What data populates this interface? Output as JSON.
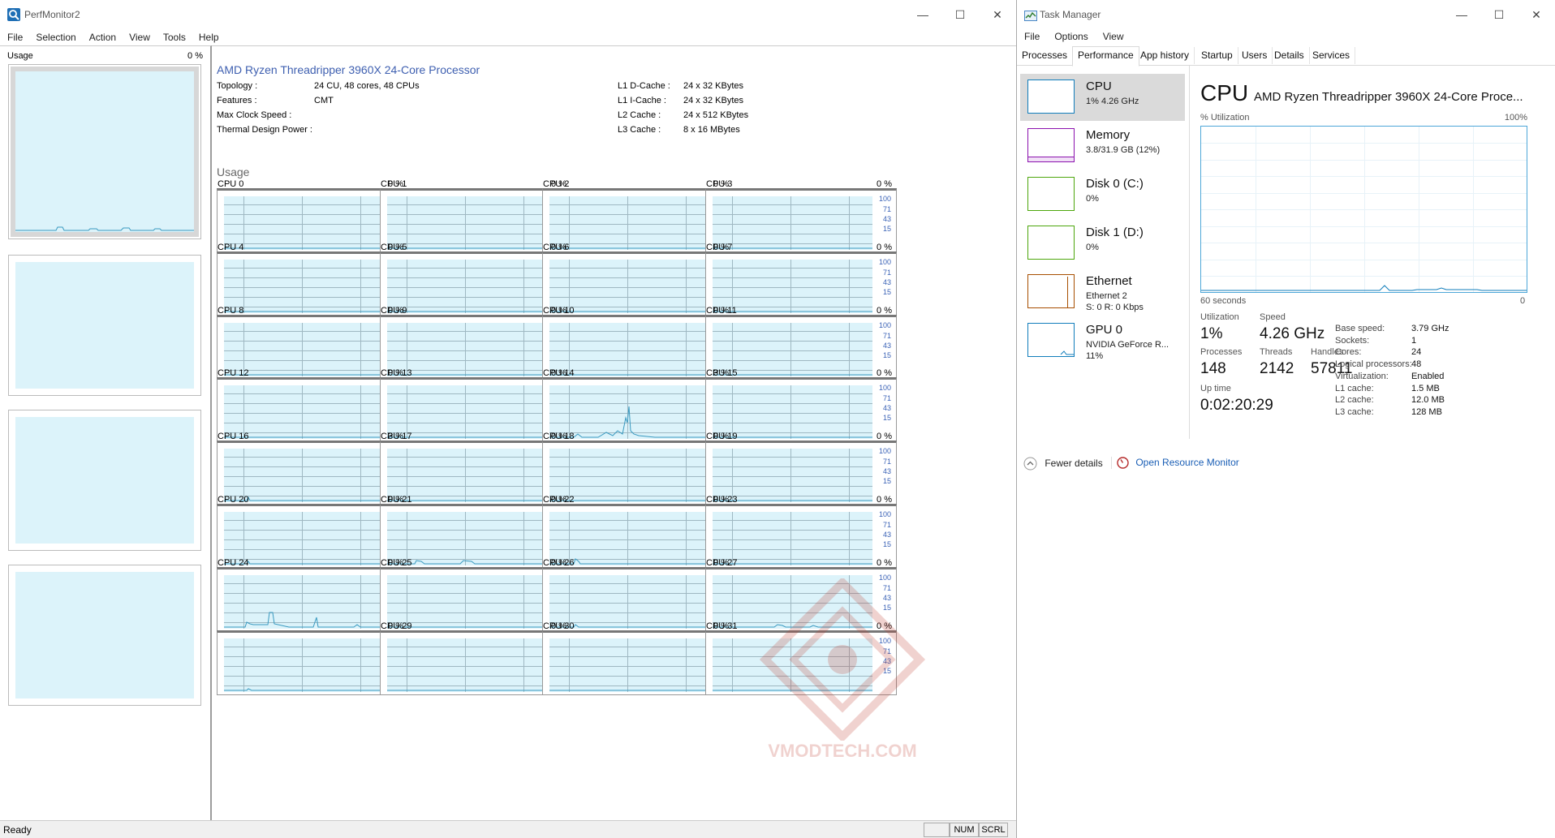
{
  "perfmon": {
    "title": "PerfMonitor2",
    "menu": [
      "File",
      "Selection",
      "Action",
      "View",
      "Tools",
      "Help"
    ],
    "left_panel": {
      "label": "Usage",
      "value": "0 %"
    },
    "processor_name": "AMD Ryzen Threadripper 3960X 24-Core Processor",
    "info_left": [
      {
        "key": "Topology :",
        "value": "24 CU, 48 cores, 48 CPUs"
      },
      {
        "key": "Features :",
        "value": "CMT"
      },
      {
        "key": "Max Clock Speed :",
        "value": ""
      },
      {
        "key": "Thermal Design Power :",
        "value": ""
      }
    ],
    "info_right": [
      {
        "key": "L1 D-Cache :",
        "value": "24 x 32 KBytes"
      },
      {
        "key": "L1 I-Cache :",
        "value": "24 x 32 KBytes"
      },
      {
        "key": "L2 Cache :",
        "value": "24 x 512 KBytes"
      },
      {
        "key": "L3 Cache :",
        "value": "8 x 16 MBytes"
      }
    ],
    "usage_heading": "Usage",
    "y_ticks": [
      "100",
      "71",
      "43",
      "15"
    ],
    "cpus": [
      {
        "label": "CPU 0",
        "value": "0 %"
      },
      {
        "label": "CPU 1",
        "value": "0 %"
      },
      {
        "label": "CPU 2",
        "value": "0 %"
      },
      {
        "label": "CPU 3",
        "value": "0 %"
      },
      {
        "label": "CPU 4",
        "value": "0 %"
      },
      {
        "label": "CPU 5",
        "value": "0 %"
      },
      {
        "label": "CPU 6",
        "value": "0 %"
      },
      {
        "label": "CPU 7",
        "value": "0 %"
      },
      {
        "label": "CPU 8",
        "value": "0 %"
      },
      {
        "label": "CPU 9",
        "value": "0 %"
      },
      {
        "label": "CPU 10",
        "value": "0 %"
      },
      {
        "label": "CPU 11",
        "value": "0 %"
      },
      {
        "label": "CPU 12",
        "value": "0 %"
      },
      {
        "label": "CPU 13",
        "value": "0 %"
      },
      {
        "label": "CPU 14",
        "value": "3 %"
      },
      {
        "label": "CPU 15",
        "value": "0 %"
      },
      {
        "label": "CPU 16",
        "value": "3 %"
      },
      {
        "label": "CPU 17",
        "value": "0 %"
      },
      {
        "label": "CPU 18",
        "value": "0 %"
      },
      {
        "label": "CPU 19",
        "value": "0 %"
      },
      {
        "label": "CPU 20",
        "value": "0 %"
      },
      {
        "label": "CPU 21",
        "value": "0 %"
      },
      {
        "label": "CPU 22",
        "value": "0 %"
      },
      {
        "label": "CPU 23",
        "value": "0 %"
      },
      {
        "label": "CPU 24",
        "value": "0 %"
      },
      {
        "label": "CPU 25",
        "value": "0 %"
      },
      {
        "label": "CPU 26",
        "value": "0 %"
      },
      {
        "label": "CPU 27",
        "value": "0 %"
      },
      {
        "label": "",
        "value": "0 %"
      },
      {
        "label": "CPU 29",
        "value": "0 %"
      },
      {
        "label": "CPU 30",
        "value": "0 %"
      },
      {
        "label": "CPU 31",
        "value": "0 %"
      }
    ],
    "status": {
      "ready": "Ready",
      "num": "NUM",
      "scrl": "SCRL"
    }
  },
  "taskmgr": {
    "title": "Task Manager",
    "menu": [
      "File",
      "Options",
      "View"
    ],
    "tabs": [
      "Processes",
      "Performance",
      "App history",
      "Startup",
      "Users",
      "Details",
      "Services"
    ],
    "active_tab": "Performance",
    "resources": [
      {
        "name": "CPU",
        "line1": "1% 4.26 GHz",
        "line2": "",
        "color": "#117dbb"
      },
      {
        "name": "Memory",
        "line1": "3.8/31.9 GB (12%)",
        "line2": "",
        "color": "#8b12ae"
      },
      {
        "name": "Disk 0 (C:)",
        "line1": "0%",
        "line2": "",
        "color": "#4da60c"
      },
      {
        "name": "Disk 1 (D:)",
        "line1": "0%",
        "line2": "",
        "color": "#4da60c"
      },
      {
        "name": "Ethernet",
        "line1": "Ethernet 2",
        "line2": "S: 0 R: 0 Kbps",
        "color": "#a74f01"
      },
      {
        "name": "GPU 0",
        "line1": "NVIDIA GeForce R...",
        "line2": "11%",
        "color": "#117dbb"
      }
    ],
    "cpu_title": "CPU",
    "cpu_name": "AMD Ryzen Threadripper 3960X 24-Core Proce...",
    "graph_top_left": "% Utilization",
    "graph_top_right": "100%",
    "graph_bottom_left": "60 seconds",
    "graph_bottom_right": "0",
    "stats": {
      "utilization_label": "Utilization",
      "utilization": "1%",
      "speed_label": "Speed",
      "speed": "4.26 GHz",
      "processes_label": "Processes",
      "processes": "148",
      "threads_label": "Threads",
      "threads": "2142",
      "handles_label": "Handles",
      "handles": "57811",
      "uptime_label": "Up time",
      "uptime": "0:02:20:29"
    },
    "details": [
      {
        "key": "Base speed:",
        "value": "3.79 GHz"
      },
      {
        "key": "Sockets:",
        "value": "1"
      },
      {
        "key": "Cores:",
        "value": "24"
      },
      {
        "key": "Logical processors:",
        "value": "48"
      },
      {
        "key": "Virtualization:",
        "value": "Enabled"
      },
      {
        "key": "L1 cache:",
        "value": "1.5 MB"
      },
      {
        "key": "L2 cache:",
        "value": "12.0 MB"
      },
      {
        "key": "L3 cache:",
        "value": "128 MB"
      }
    ],
    "fewer_details": "Fewer details",
    "open_resource_monitor": "Open Resource Monitor"
  },
  "watermark": "VMODTECH.COM"
}
